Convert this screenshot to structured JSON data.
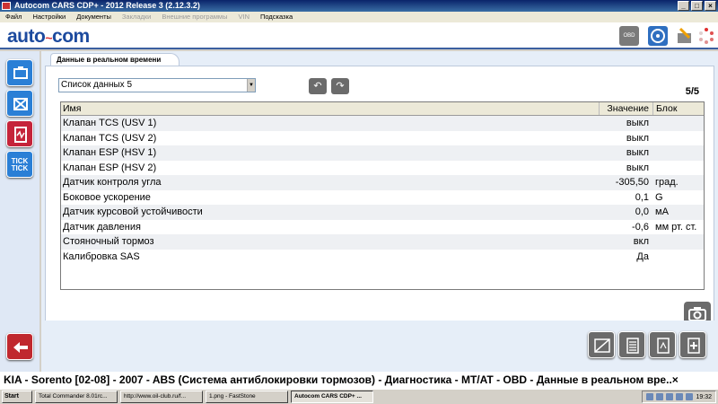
{
  "window": {
    "title": "Autocom CARS CDP+ - 2012 Release 3 (2.12.3.2)",
    "buttons": [
      "_",
      "□",
      "×"
    ]
  },
  "menu": {
    "items": [
      {
        "label": "Файл",
        "enabled": true
      },
      {
        "label": "Настройки",
        "enabled": true
      },
      {
        "label": "Документы",
        "enabled": true
      },
      {
        "label": "Закладки",
        "enabled": false
      },
      {
        "label": "Внешние программы",
        "enabled": false
      },
      {
        "label": "VIN",
        "enabled": false
      },
      {
        "label": "Подсказка",
        "enabled": true
      }
    ]
  },
  "header": {
    "logo_main": "auto",
    "logo_accent": "~",
    "logo_tail": "com",
    "obd_label": "OBD"
  },
  "sidebar": {
    "tick_label_1": "TICK",
    "tick_label_2": "TICK"
  },
  "main": {
    "tab_label": "Данные в реальном времени",
    "selector": {
      "value": "Список данных 5"
    },
    "page_indicator": "5/5",
    "table": {
      "columns": {
        "name": "Имя",
        "value": "Значение",
        "unit": "Блок"
      },
      "rows": [
        {
          "name": "Клапан TCS (USV 1)",
          "value": "выкл",
          "unit": ""
        },
        {
          "name": "Клапан TCS (USV 2)",
          "value": "выкл",
          "unit": ""
        },
        {
          "name": "Клапан ESP (HSV 1)",
          "value": "выкл",
          "unit": ""
        },
        {
          "name": "Клапан ESP (HSV 2)",
          "value": "выкл",
          "unit": ""
        },
        {
          "name": "Датчик контроля угла",
          "value": "-305,50",
          "unit": "град."
        },
        {
          "name": "Боковое ускорение",
          "value": "0,1",
          "unit": "G"
        },
        {
          "name": "Датчик курсовой устойчивости",
          "value": "0,0",
          "unit": "мА"
        },
        {
          "name": "Датчик давления",
          "value": "-0,6",
          "unit": "мм рт. ст."
        },
        {
          "name": "Стояночный тормоз",
          "value": "вкл",
          "unit": ""
        },
        {
          "name": "Калибровка SAS",
          "value": "Да",
          "unit": ""
        }
      ]
    }
  },
  "status": {
    "text": "KIA - Sorento [02-08] - 2007 - ABS (Система антиблокировки тормозов) - Диагностика - MT/AT - OBD - Данные в реальном вре..×"
  },
  "taskbar": {
    "start_label": "Start",
    "tasks": [
      {
        "label": "Total Commander 8.01rc...",
        "active": false
      },
      {
        "label": "http://www.oil-club.ru/f...",
        "active": false
      },
      {
        "label": "1.png - FastStone",
        "active": false
      },
      {
        "label": "Autocom CARS CDP+ ...",
        "active": true
      }
    ],
    "clock": "19:32"
  },
  "colors": {
    "brand_blue": "#1c4a9e",
    "accent_red": "#c5243a",
    "sidebar_blue": "#2a7fd6",
    "button_gray": "#6b6b6b"
  }
}
